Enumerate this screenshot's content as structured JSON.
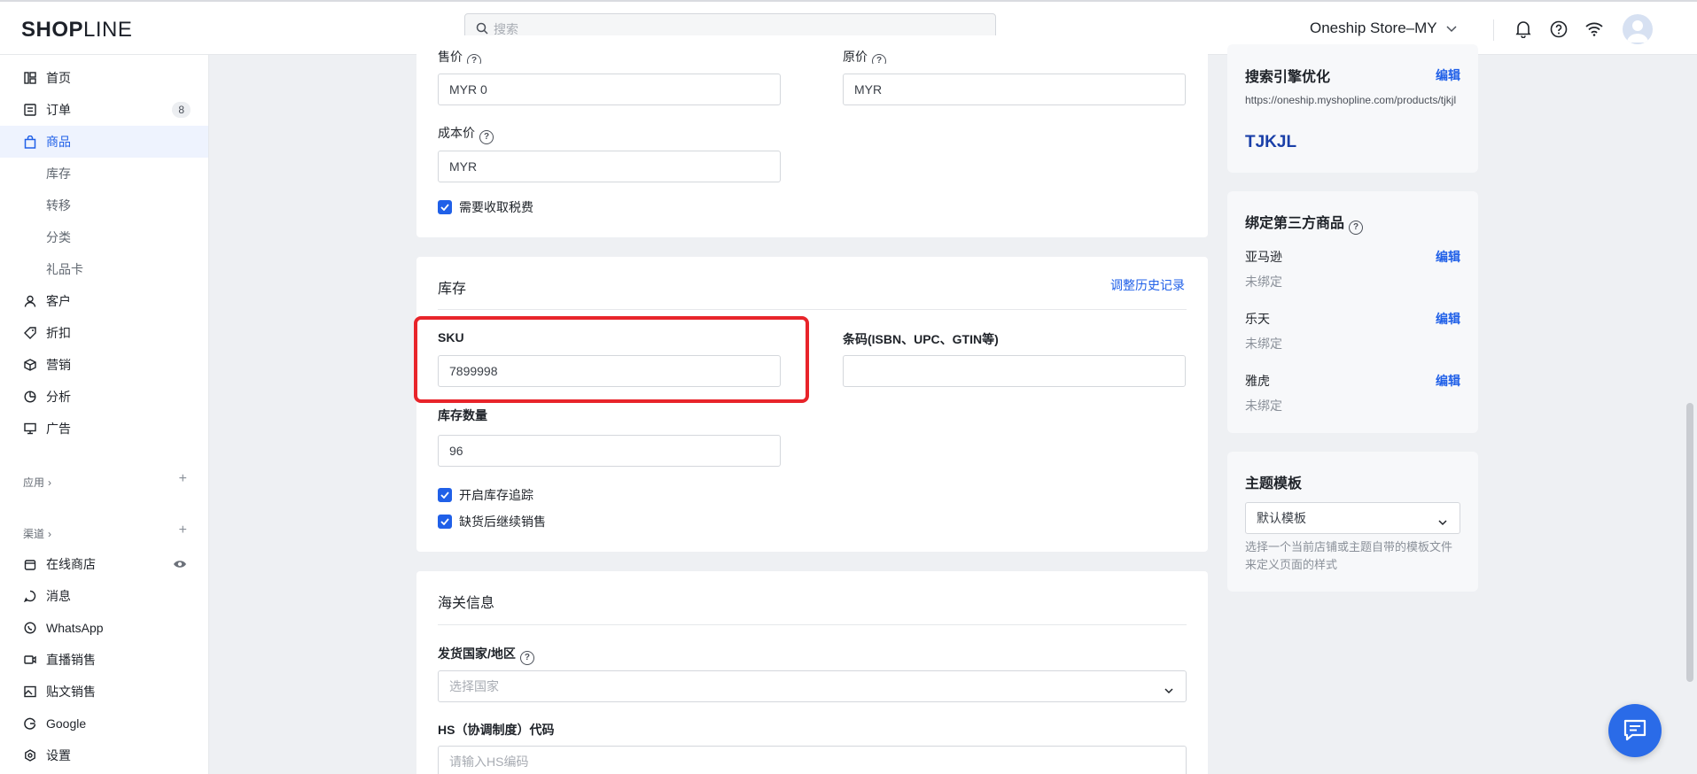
{
  "brand": {
    "logo_bold": "SHOP",
    "logo_light": "LINE"
  },
  "header": {
    "search_placeholder": "搜索",
    "store_name": "Oneship Store–MY"
  },
  "sidebar": {
    "items": [
      {
        "label": "首页"
      },
      {
        "label": "订单",
        "badge": "8"
      },
      {
        "label": "商品"
      },
      {
        "label": "库存"
      },
      {
        "label": "转移"
      },
      {
        "label": "分类"
      },
      {
        "label": "礼品卡"
      },
      {
        "label": "客户"
      },
      {
        "label": "折扣"
      },
      {
        "label": "营销"
      },
      {
        "label": "分析"
      },
      {
        "label": "广告"
      }
    ],
    "apps_label": "应用",
    "channels_label": "渠道",
    "channels": [
      {
        "label": "在线商店"
      },
      {
        "label": "消息"
      },
      {
        "label": "WhatsApp"
      },
      {
        "label": "直播销售"
      },
      {
        "label": "贴文销售"
      },
      {
        "label": "Google"
      },
      {
        "label": "设置"
      }
    ]
  },
  "pricing": {
    "price_label": "售价",
    "price_value": "MYR  0",
    "compare_label": "原价",
    "compare_value": "MYR",
    "cost_label": "成本价",
    "cost_value": "MYR",
    "tax_label": "需要收取税费"
  },
  "inventory": {
    "title": "库存",
    "history_link": "调整历史记录",
    "sku_label": "SKU",
    "sku_value": "7899998",
    "barcode_label": "条码(ISBN、UPC、GTIN等)",
    "barcode_value": "",
    "qty_label": "库存数量",
    "qty_value": "96",
    "track_label": "开启库存追踪",
    "oversell_label": "缺货后继续销售"
  },
  "customs": {
    "title": "海关信息",
    "country_label": "发货国家/地区",
    "country_placeholder": "选择国家",
    "hs_label": "HS（协调制度）代码",
    "hs_placeholder": "请输入HS编码"
  },
  "seo": {
    "title": "搜索引擎优化",
    "edit": "编辑",
    "url": "https://oneship.myshopline.com/products/tjkjl",
    "page_title": "TJKJL"
  },
  "binding": {
    "title": "绑定第三方商品",
    "platforms": [
      {
        "name": "亚马逊",
        "status": "未绑定",
        "edit": "编辑"
      },
      {
        "name": "乐天",
        "status": "未绑定",
        "edit": "编辑"
      },
      {
        "name": "雅虎",
        "status": "未绑定",
        "edit": "编辑"
      }
    ]
  },
  "theme": {
    "title": "主题模板",
    "selected": "默认模板",
    "hint": "选择一个当前店铺或主题自带的模板文件来定义页面的样式"
  },
  "colors": {
    "accent": "#2060e8",
    "highlight": "#e8242a",
    "fab": "#2a6be8"
  }
}
